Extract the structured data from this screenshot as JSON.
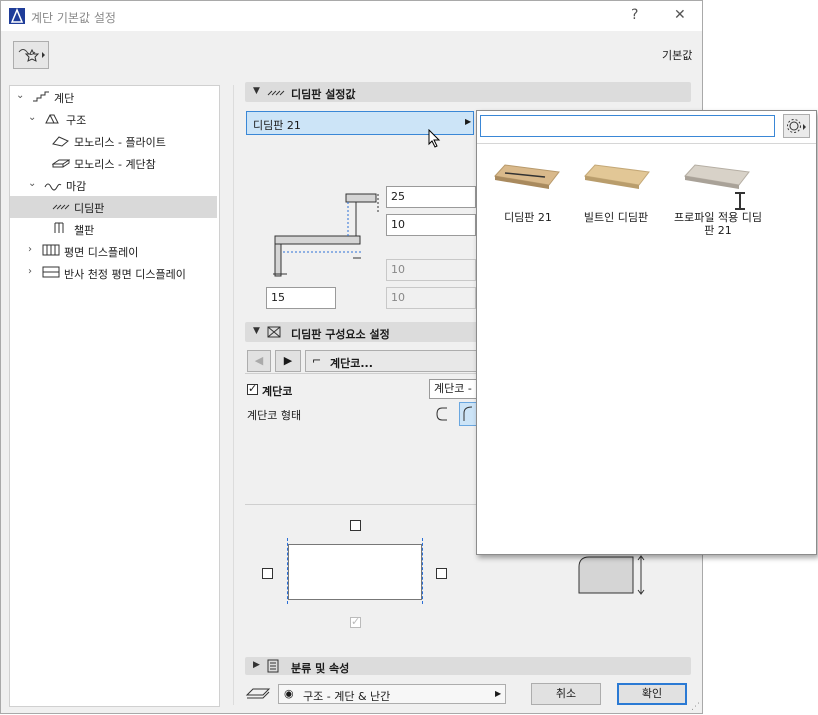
{
  "window": {
    "title": "계단 기본값 설정",
    "help_glyph": "?",
    "close_glyph": "✕"
  },
  "header": {
    "defaults_label": "기본값",
    "favorites_icon": "favorites-star-icon"
  },
  "tree": {
    "items": [
      {
        "label": "계단",
        "icon": "stair-icon",
        "toggle": "⌄"
      },
      {
        "label": "구조",
        "icon": "structure-icon",
        "toggle": "⌄"
      },
      {
        "label": "모노리스 - 플라이트",
        "icon": "flight-icon"
      },
      {
        "label": "모노리스 - 계단참",
        "icon": "landing-icon"
      },
      {
        "label": "마감",
        "icon": "finish-icon",
        "toggle": "⌄"
      },
      {
        "label": "디딤판",
        "icon": "tread-icon"
      },
      {
        "label": "챌판",
        "icon": "riser-icon"
      },
      {
        "label": "평면 디스플레이",
        "icon": "floorplan-icon",
        "toggle": "›"
      },
      {
        "label": "반사 천정 평면 디스플레이",
        "icon": "rcp-icon",
        "toggle": "›"
      }
    ]
  },
  "tread_settings": {
    "section_title": "디딤판 설정값",
    "selector_value": "디딤판 21",
    "thickness": "25",
    "nosing": "10",
    "dim_a": "10",
    "dim_b": "10",
    "offset": "15"
  },
  "component_settings": {
    "section_title": "디딤판 구성요소 설정",
    "nav_item": "계단코...",
    "nosing_checkbox_label": "계단코",
    "nosing_select_value": "계단코 -",
    "nosing_shape_label": "계단코 형태"
  },
  "classification": {
    "section_title": "분류 및 속성"
  },
  "footer": {
    "layer_value": "구조 - 계단 & 난간",
    "cancel_label": "취소",
    "ok_label": "확인"
  },
  "library_popup": {
    "search_placeholder": "",
    "items": [
      {
        "label": "디딤판 21",
        "color": "#d9b98b"
      },
      {
        "label": "빌트인 디딤판",
        "color": "#e2c796"
      },
      {
        "label": "프로파일 적용 디딤판 21",
        "color": "#d8d2c8"
      }
    ]
  }
}
